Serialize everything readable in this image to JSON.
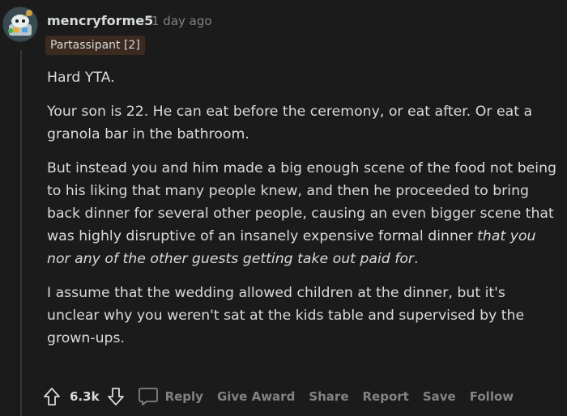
{
  "comment": {
    "author": "mencryforme5",
    "separator": "·",
    "time": "1 day ago",
    "flair": "Partassipant [2]",
    "paragraphs": {
      "p1": "Hard YTA.",
      "p2": "Your son is 22. He can eat before the ceremony, or eat after. Or eat a granola bar in the bathroom.",
      "p3_plain": "But instead you and him made a big enough scene of the food not being to his liking that many people knew, and then he proceeded to bring back dinner for several other people, causing an even bigger scene that was highly disruptive of an insanely expensive formal dinner ",
      "p3_italic": "that you nor any of the other guests getting take out paid for",
      "p3_end": ".",
      "p4": "I assume that the wedding allowed children at the dinner, but it's unclear why you weren't sat at the kids table and supervised by the grown-ups."
    }
  },
  "actions": {
    "score": "6.3k",
    "reply": "Reply",
    "give_award": "Give Award",
    "share": "Share",
    "report": "Report",
    "save": "Save",
    "follow": "Follow"
  },
  "icons": {
    "avatar": "snoo-avatar-icon",
    "upvote": "upvote-arrow-icon",
    "downvote": "downvote-arrow-icon",
    "reply": "speech-bubble-icon"
  },
  "colors": {
    "background": "#1b1b1b",
    "text": "#d7dadc",
    "muted": "#818384",
    "flair_bg": "#3a2a20"
  }
}
